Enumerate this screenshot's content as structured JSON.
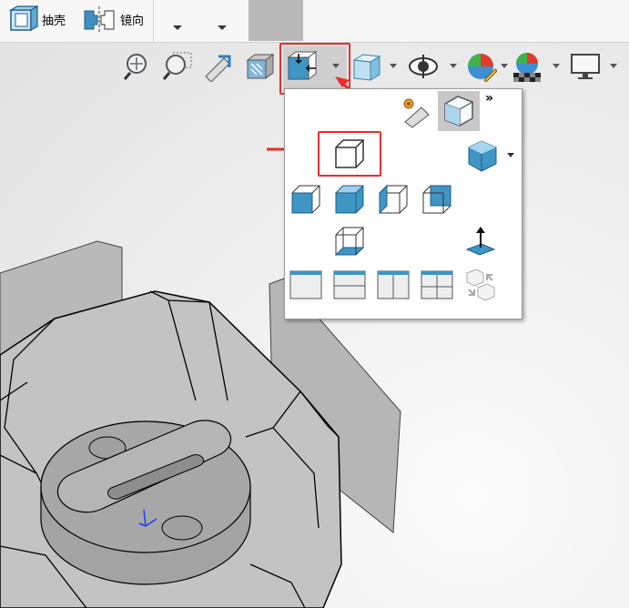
{
  "ribbon": {
    "shell_label": "抽壳",
    "mirror_label": "镜向"
  },
  "hud": {
    "icons": [
      "zoom-to-fit-icon",
      "zoom-area-icon",
      "previous-view-icon",
      "section-view-icon",
      "view-orientation-icon",
      "display-style-icon",
      "hide-show-items-icon",
      "edit-appearance-icon",
      "apply-scene-icon",
      "view-settings-icon"
    ]
  },
  "popup": {
    "more_glyph": "»",
    "views": [
      "front-view",
      "top-view",
      "left-view",
      "back-view",
      "bottom-view",
      "right-view",
      "isometric-view",
      "normal-to",
      "single-view",
      "two-view-horizontal",
      "two-view-vertical",
      "four-view",
      "link-views"
    ]
  },
  "colors": {
    "highlight": "#ee2b2b",
    "cube_blue": "#3f95c4",
    "model_fill": "#b8b8b8"
  }
}
